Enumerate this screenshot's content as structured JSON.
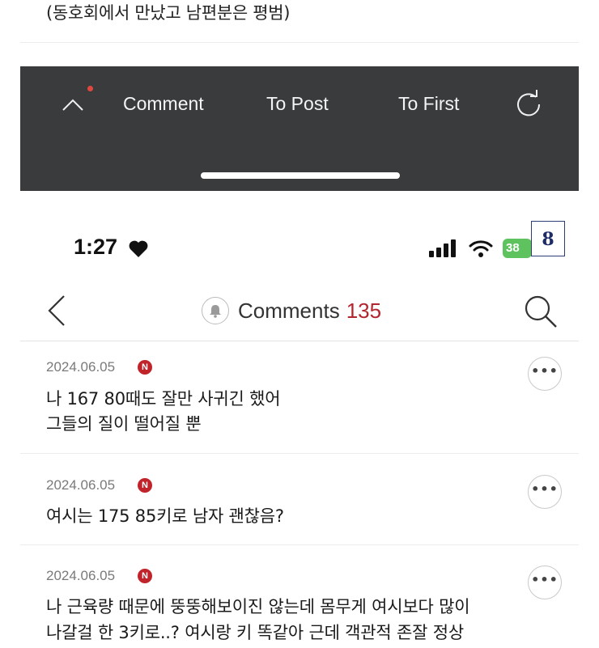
{
  "top_snippet": "(동호회에서 만났고 남편분은 평범)",
  "toolbar": {
    "comment_label": "Comment",
    "to_post_label": "To Post",
    "to_first_label": "To First",
    "up_icon": "chevron-up-icon",
    "refresh_icon": "refresh-icon",
    "notification_dot_color": "#e0483f"
  },
  "status_bar": {
    "time": "1:27",
    "battery": "38",
    "battery_color": "#5ec25e"
  },
  "page_badge": "8",
  "header": {
    "title": "Comments",
    "count": "135",
    "count_color": "#b3262e"
  },
  "comments": [
    {
      "date": "2024.06.05",
      "badge": "N",
      "lines": [
        "나 167 80때도 잘만 사귀긴 했어",
        "그들의 질이 떨어질 뿐"
      ]
    },
    {
      "date": "2024.06.05",
      "badge": "N",
      "lines": [
        "여시는 175 85키로 남자 괜찮음?"
      ]
    },
    {
      "date": "2024.06.05",
      "badge": "N",
      "lines": [
        "나 근육량 때문에 뚱뚱해보이진 않는데 몸무게 여시보다 많이",
        "나갈걸 한 3키로..? 여시랑 키 똑같아 근데 객관적 존잘 정상"
      ]
    }
  ],
  "more_label": "•••"
}
